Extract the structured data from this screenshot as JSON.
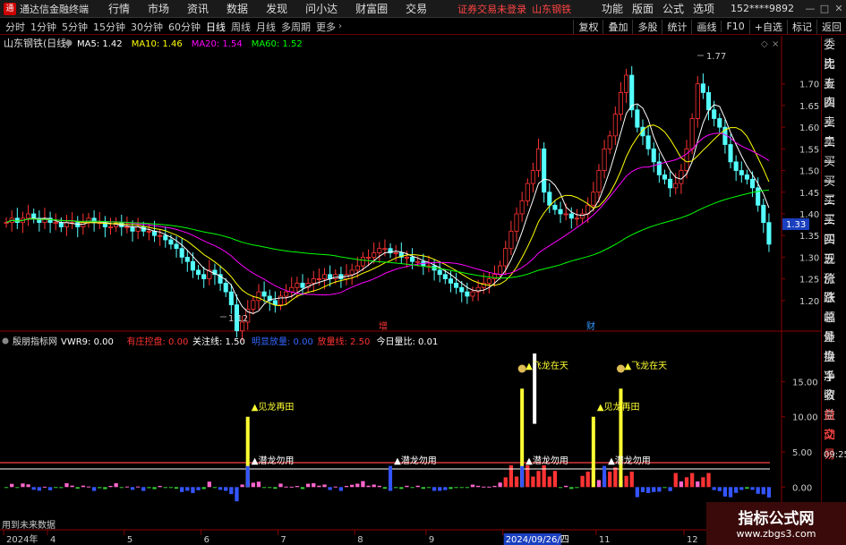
{
  "titlebar": {
    "app_name": "通达信金融终端",
    "menus": [
      "行情",
      "市场",
      "资讯",
      "数据",
      "发现",
      "问小达",
      "财富圈",
      "交易"
    ],
    "login_status": "证券交易未登录",
    "stock_tag": "山东钢铁",
    "right_menus": [
      "功能",
      "版面",
      "公式",
      "选项"
    ],
    "account": "152****9892",
    "win_buttons": [
      "—",
      "□",
      "✕"
    ]
  },
  "periodbar": {
    "periods": [
      "分时",
      "1分钟",
      "5分钟",
      "15分钟",
      "30分钟",
      "60分钟",
      "日线",
      "周线",
      "月线",
      "多周期",
      "更多"
    ],
    "active": "日线",
    "tools": [
      "复权",
      "叠加",
      "多股",
      "统计",
      "画线",
      "F10",
      "+自选",
      "标记",
      "返回"
    ]
  },
  "main_panel": {
    "stock_label": "山东钢铁(日线)",
    "indicators": [
      {
        "name": "MA5",
        "value": "1.42",
        "color": "#ffffff"
      },
      {
        "name": "MA10",
        "value": "1.46",
        "color": "#ffff00"
      },
      {
        "name": "MA20",
        "value": "1.54",
        "color": "#ff00ff"
      },
      {
        "name": "MA60",
        "value": "1.52",
        "color": "#00ff00"
      }
    ],
    "high_label": "1.77",
    "low_label": "1.12",
    "current_price": "1.33",
    "event_marks": [
      "增",
      "财"
    ],
    "price_axis": [
      "1.70",
      "1.65",
      "1.60",
      "1.55",
      "1.50",
      "1.45",
      "1.40",
      "1.35",
      "1.30",
      "1.25",
      "1.20"
    ]
  },
  "sub_panel": {
    "name": "殷朋指标网",
    "indicators": [
      {
        "name": "VWR9:",
        "value": "0.00",
        "color": "#ffffff"
      },
      {
        "name": "有庄控盘:",
        "value": "0.00",
        "color": "#ff3333"
      },
      {
        "name": "关注线:",
        "value": "1.50",
        "color": "#ffffff"
      },
      {
        "name": "明显放量:",
        "value": "0.00",
        "color": "#3366ff"
      },
      {
        "name": "放量线:",
        "value": "2.50",
        "color": "#ff3333"
      },
      {
        "name": "今日量比:",
        "value": "0.01",
        "color": "#ffffff"
      }
    ],
    "axis": [
      "15.00",
      "10.00",
      "5.00",
      "0.00"
    ],
    "signals": [
      "见龙再田",
      "潜龙勿用",
      "潜龙勿用",
      "飞龙在天",
      "飞龙在天",
      "见龙再田",
      "潜龙勿用",
      "潜龙勿用"
    ],
    "future_note": "用到未来数据"
  },
  "date_axis": {
    "labels": [
      "2024年",
      "4",
      "5",
      "6",
      "7",
      "8",
      "9",
      "2024/09/26/四",
      "11",
      "12"
    ]
  },
  "sidepanel": {
    "items": [
      "委比",
      "卖五",
      "卖四",
      "卖三",
      "卖二",
      "卖一",
      "买一",
      "买二",
      "买三",
      "买四",
      "买五",
      "现价",
      "涨跌",
      "涨幅",
      "总量",
      "外盘",
      "换手",
      "净资",
      "收益",
      "自动",
      "交易"
    ],
    "time": "09:25"
  },
  "watermark": {
    "title": "指标公式网",
    "url": "www.zbgs3.com"
  },
  "chart_data": {
    "type": "candlestick",
    "price_range": [
      1.15,
      1.78
    ],
    "sub_range": [
      -2,
      19
    ],
    "close_series": [
      1.38,
      1.39,
      1.38,
      1.39,
      1.4,
      1.39,
      1.38,
      1.39,
      1.38,
      1.38,
      1.37,
      1.38,
      1.38,
      1.37,
      1.38,
      1.39,
      1.38,
      1.38,
      1.37,
      1.37,
      1.38,
      1.37,
      1.37,
      1.36,
      1.37,
      1.36,
      1.36,
      1.35,
      1.35,
      1.34,
      1.33,
      1.32,
      1.3,
      1.29,
      1.27,
      1.26,
      1.25,
      1.27,
      1.26,
      1.24,
      1.22,
      1.19,
      1.13,
      1.15,
      1.18,
      1.2,
      1.22,
      1.21,
      1.2,
      1.19,
      1.21,
      1.22,
      1.23,
      1.24,
      1.23,
      1.24,
      1.25,
      1.25,
      1.26,
      1.25,
      1.26,
      1.25,
      1.26,
      1.27,
      1.28,
      1.3,
      1.3,
      1.31,
      1.32,
      1.32,
      1.31,
      1.31,
      1.3,
      1.3,
      1.29,
      1.29,
      1.28,
      1.28,
      1.27,
      1.26,
      1.25,
      1.24,
      1.23,
      1.22,
      1.21,
      1.22,
      1.23,
      1.24,
      1.25,
      1.26,
      1.28,
      1.32,
      1.36,
      1.4,
      1.43,
      1.47,
      1.5,
      1.55,
      1.45,
      1.42,
      1.41,
      1.4,
      1.4,
      1.39,
      1.39,
      1.4,
      1.42,
      1.45,
      1.5,
      1.55,
      1.58,
      1.63,
      1.68,
      1.72,
      1.64,
      1.6,
      1.58,
      1.55,
      1.52,
      1.49,
      1.48,
      1.46,
      1.47,
      1.5,
      1.55,
      1.62,
      1.7,
      1.68,
      1.64,
      1.62,
      1.6,
      1.56,
      1.52,
      1.5,
      1.49,
      1.48,
      1.46,
      1.42,
      1.38,
      1.33
    ]
  }
}
